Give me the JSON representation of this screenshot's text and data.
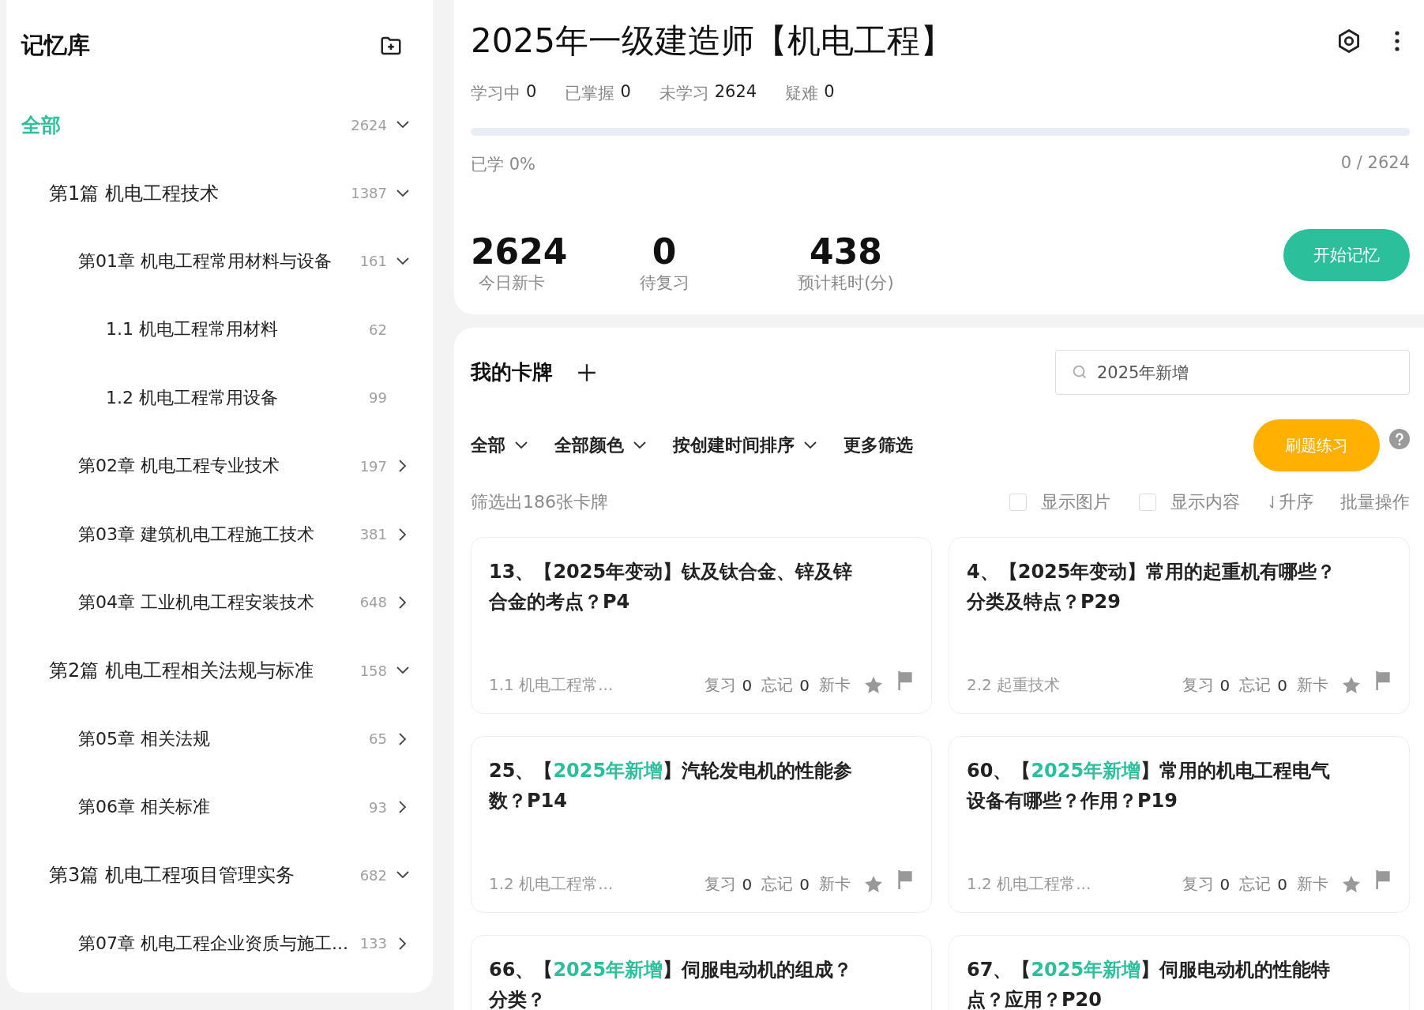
{
  "sidebar": {
    "title": "记忆库",
    "tree": [
      {
        "label": "全部",
        "count": "2624",
        "selected": true,
        "expanded": true,
        "children": [
          {
            "label": "第1篇 机电工程技术",
            "count": "1387",
            "selected": false,
            "expanded": true,
            "children": [
              {
                "label": "第01章 机电工程常用材料与设备",
                "count": "161",
                "selected": false,
                "expanded": true,
                "children": [
                  {
                    "label": "1.1 机电工程常用材料",
                    "count": "62",
                    "selected": false
                  },
                  {
                    "label": "1.2 机电工程常用设备",
                    "count": "99",
                    "selected": false
                  }
                ]
              },
              {
                "label": "第02章 机电工程专业技术",
                "count": "197",
                "selected": false,
                "expanded": false
              },
              {
                "label": "第03章 建筑机电工程施工技术",
                "count": "381",
                "selected": false,
                "expanded": false
              },
              {
                "label": "第04章 工业机电工程安装技术",
                "count": "648",
                "selected": false,
                "expanded": false
              }
            ]
          },
          {
            "label": "第2篇 机电工程相关法规与标准",
            "count": "158",
            "selected": false,
            "expanded": true,
            "children": [
              {
                "label": "第05章 相关法规",
                "count": "65",
                "selected": false,
                "expanded": false
              },
              {
                "label": "第06章 相关标准",
                "count": "93",
                "selected": false,
                "expanded": false
              }
            ]
          },
          {
            "label": "第3篇 机电工程项目管理实务",
            "count": "682",
            "selected": false,
            "expanded": true,
            "children": [
              {
                "label": "第07章 机电工程企业资质与施工...",
                "count": "133",
                "selected": false,
                "expanded": false
              }
            ]
          }
        ]
      }
    ]
  },
  "deck": {
    "title": "2025年一级建造师【机电工程】",
    "stats": [
      {
        "label": "学习中",
        "value": "0"
      },
      {
        "label": "已掌握",
        "value": "0"
      },
      {
        "label": "未学习",
        "value": "2624"
      },
      {
        "label": "疑难",
        "value": "0"
      }
    ],
    "progress": {
      "level": 0,
      "label": "已学 0%",
      "reading": "0 / 2624"
    },
    "summary": [
      {
        "value": "2624",
        "label": "今日新卡"
      },
      {
        "value": "0",
        "label": "待复习"
      },
      {
        "value": "438",
        "label": "预计耗时(分)"
      }
    ],
    "start_button": "开始记忆"
  },
  "cards_panel": {
    "title": "我的卡牌",
    "search": {
      "value": "2025年新增"
    },
    "filters": [
      {
        "label": "全部",
        "dropdown": true
      },
      {
        "label": "全部颜色",
        "dropdown": true
      },
      {
        "label": "按创建时间排序",
        "dropdown": true
      },
      {
        "label": "更多筛选",
        "dropdown": false
      }
    ],
    "practice_button": "刷题练习",
    "result_count": "筛选出186张卡牌",
    "options": [
      {
        "label": "显示图片",
        "checked": false
      },
      {
        "label": "显示内容",
        "checked": false
      }
    ],
    "sort": "升序",
    "batch": "批量操作",
    "cards": [
      {
        "title": [
          {
            "text": "13、【2025年变动】钛及钛合金、锌及锌合金的考点？P4",
            "highlight": false
          }
        ],
        "chapter": "1.1 机电工程常...",
        "stats": [
          {
            "label": "复习",
            "value": "0"
          },
          {
            "label": "忘记",
            "value": "0"
          }
        ],
        "status": "新卡"
      },
      {
        "title": [
          {
            "text": "4、【2025年变动】常用的起重机有哪些？分类及特点？P29",
            "highlight": false
          }
        ],
        "chapter": "2.2 起重技术",
        "stats": [
          {
            "label": "复习",
            "value": "0"
          },
          {
            "label": "忘记",
            "value": "0"
          }
        ],
        "status": "新卡"
      },
      {
        "title": [
          {
            "text": "25、【",
            "highlight": false
          },
          {
            "text": "2025年新增",
            "highlight": true
          },
          {
            "text": "】汽轮发电机的性能参数？P14",
            "highlight": false
          }
        ],
        "chapter": "1.2 机电工程常...",
        "stats": [
          {
            "label": "复习",
            "value": "0"
          },
          {
            "label": "忘记",
            "value": "0"
          }
        ],
        "status": "新卡"
      },
      {
        "title": [
          {
            "text": "60、【",
            "highlight": false
          },
          {
            "text": "2025年新增",
            "highlight": true
          },
          {
            "text": "】常用的机电工程电气设备有哪些？作用？P19",
            "highlight": false
          }
        ],
        "chapter": "1.2 机电工程常...",
        "stats": [
          {
            "label": "复习",
            "value": "0"
          },
          {
            "label": "忘记",
            "value": "0"
          }
        ],
        "status": "新卡"
      },
      {
        "title": [
          {
            "text": "66、【",
            "highlight": false
          },
          {
            "text": "2025年新增",
            "highlight": true
          },
          {
            "text": "】伺服电动机的组成？分类？",
            "highlight": false
          }
        ]
      },
      {
        "title": [
          {
            "text": "67、【",
            "highlight": false
          },
          {
            "text": "2025年新增",
            "highlight": true
          },
          {
            "text": "】伺服电动机的性能特点？应用？P20",
            "highlight": false
          }
        ]
      }
    ]
  }
}
